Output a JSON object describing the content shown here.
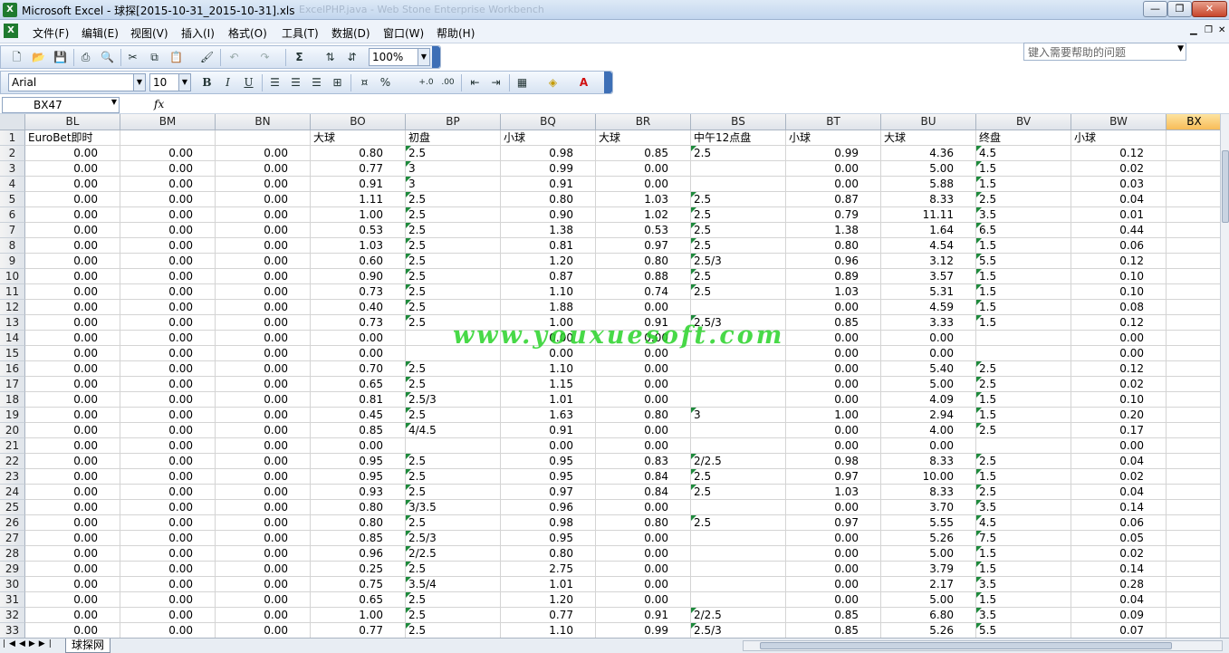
{
  "window": {
    "title": "Microsoft Excel - 球探[2015-10-31_2015-10-31].xls",
    "ghost_title": "ExcelPHP.java - Web Stone Enterprise Workbench",
    "icon": "excel-icon"
  },
  "menu": {
    "items": [
      "文件(F)",
      "编辑(E)",
      "视图(V)",
      "插入(I)",
      "格式(O)",
      "工具(T)",
      "数据(D)",
      "窗口(W)",
      "帮助(H)"
    ],
    "help_placeholder": "键入需要帮助的问题"
  },
  "toolbar": {
    "zoom": "100%",
    "font_name": "Arial",
    "font_size": "10",
    "sum_glyph": "Σ",
    "bold": "B",
    "italic": "I",
    "underline": "U",
    "percent": "%"
  },
  "formula_bar": {
    "name_box": "BX47",
    "fx": "fx",
    "value": ""
  },
  "sheet": {
    "columns": [
      "BL",
      "BM",
      "BN",
      "BO",
      "BP",
      "BQ",
      "BR",
      "BS",
      "BT",
      "BU",
      "BV",
      "BW",
      "BX"
    ],
    "selected_column": "BX",
    "rows": [
      {
        "n": "1",
        "cells": [
          "EuroBet即时",
          "",
          "",
          "大球",
          "初盘",
          "小球",
          "大球",
          "中午12点盘",
          "小球",
          "大球",
          "终盘",
          "小球",
          ""
        ]
      },
      {
        "n": "2",
        "cells": [
          "0.00",
          "0.00",
          "0.00",
          "0.80",
          "2.5",
          "0.98",
          "0.85",
          "2.5",
          "0.99",
          "4.36",
          "4.5",
          "0.12",
          ""
        ]
      },
      {
        "n": "3",
        "cells": [
          "0.00",
          "0.00",
          "0.00",
          "0.77",
          "3",
          "0.99",
          "0.00",
          "",
          "0.00",
          "5.00",
          "1.5",
          "0.02",
          ""
        ]
      },
      {
        "n": "4",
        "cells": [
          "0.00",
          "0.00",
          "0.00",
          "0.91",
          "3",
          "0.91",
          "0.00",
          "",
          "0.00",
          "5.88",
          "1.5",
          "0.03",
          ""
        ]
      },
      {
        "n": "5",
        "cells": [
          "0.00",
          "0.00",
          "0.00",
          "1.11",
          "2.5",
          "0.80",
          "1.03",
          "2.5",
          "0.87",
          "8.33",
          "2.5",
          "0.04",
          ""
        ]
      },
      {
        "n": "6",
        "cells": [
          "0.00",
          "0.00",
          "0.00",
          "1.00",
          "2.5",
          "0.90",
          "1.02",
          "2.5",
          "0.79",
          "11.11",
          "3.5",
          "0.01",
          ""
        ]
      },
      {
        "n": "7",
        "cells": [
          "0.00",
          "0.00",
          "0.00",
          "0.53",
          "2.5",
          "1.38",
          "0.53",
          "2.5",
          "1.38",
          "1.64",
          "6.5",
          "0.44",
          ""
        ]
      },
      {
        "n": "8",
        "cells": [
          "0.00",
          "0.00",
          "0.00",
          "1.03",
          "2.5",
          "0.81",
          "0.97",
          "2.5",
          "0.80",
          "4.54",
          "1.5",
          "0.06",
          ""
        ]
      },
      {
        "n": "9",
        "cells": [
          "0.00",
          "0.00",
          "0.00",
          "0.60",
          "2.5",
          "1.20",
          "0.80",
          "2.5/3",
          "0.96",
          "3.12",
          "5.5",
          "0.12",
          ""
        ]
      },
      {
        "n": "10",
        "cells": [
          "0.00",
          "0.00",
          "0.00",
          "0.90",
          "2.5",
          "0.87",
          "0.88",
          "2.5",
          "0.89",
          "3.57",
          "1.5",
          "0.10",
          ""
        ]
      },
      {
        "n": "11",
        "cells": [
          "0.00",
          "0.00",
          "0.00",
          "0.73",
          "2.5",
          "1.10",
          "0.74",
          "2.5",
          "1.03",
          "5.31",
          "1.5",
          "0.10",
          ""
        ]
      },
      {
        "n": "12",
        "cells": [
          "0.00",
          "0.00",
          "0.00",
          "0.40",
          "2.5",
          "1.88",
          "0.00",
          "",
          "0.00",
          "4.59",
          "1.5",
          "0.08",
          ""
        ]
      },
      {
        "n": "13",
        "cells": [
          "0.00",
          "0.00",
          "0.00",
          "0.73",
          "2.5",
          "1.00",
          "0.91",
          "2.5/3",
          "0.85",
          "3.33",
          "1.5",
          "0.12",
          ""
        ]
      },
      {
        "n": "14",
        "cells": [
          "0.00",
          "0.00",
          "0.00",
          "0.00",
          "",
          "0.00",
          "0.00",
          "",
          "0.00",
          "0.00",
          "",
          "0.00",
          ""
        ]
      },
      {
        "n": "15",
        "cells": [
          "0.00",
          "0.00",
          "0.00",
          "0.00",
          "",
          "0.00",
          "0.00",
          "",
          "0.00",
          "0.00",
          "",
          "0.00",
          ""
        ]
      },
      {
        "n": "16",
        "cells": [
          "0.00",
          "0.00",
          "0.00",
          "0.70",
          "2.5",
          "1.10",
          "0.00",
          "",
          "0.00",
          "5.40",
          "2.5",
          "0.12",
          ""
        ]
      },
      {
        "n": "17",
        "cells": [
          "0.00",
          "0.00",
          "0.00",
          "0.65",
          "2.5",
          "1.15",
          "0.00",
          "",
          "0.00",
          "5.00",
          "2.5",
          "0.02",
          ""
        ]
      },
      {
        "n": "18",
        "cells": [
          "0.00",
          "0.00",
          "0.00",
          "0.81",
          "2.5/3",
          "1.01",
          "0.00",
          "",
          "0.00",
          "4.09",
          "1.5",
          "0.10",
          ""
        ]
      },
      {
        "n": "19",
        "cells": [
          "0.00",
          "0.00",
          "0.00",
          "0.45",
          "2.5",
          "1.63",
          "0.80",
          "3",
          "1.00",
          "2.94",
          "1.5",
          "0.20",
          ""
        ]
      },
      {
        "n": "20",
        "cells": [
          "0.00",
          "0.00",
          "0.00",
          "0.85",
          "4/4.5",
          "0.91",
          "0.00",
          "",
          "0.00",
          "4.00",
          "2.5",
          "0.17",
          ""
        ]
      },
      {
        "n": "21",
        "cells": [
          "0.00",
          "0.00",
          "0.00",
          "0.00",
          "",
          "0.00",
          "0.00",
          "",
          "0.00",
          "0.00",
          "",
          "0.00",
          ""
        ]
      },
      {
        "n": "22",
        "cells": [
          "0.00",
          "0.00",
          "0.00",
          "0.95",
          "2.5",
          "0.95",
          "0.83",
          "2/2.5",
          "0.98",
          "8.33",
          "2.5",
          "0.04",
          ""
        ]
      },
      {
        "n": "23",
        "cells": [
          "0.00",
          "0.00",
          "0.00",
          "0.95",
          "2.5",
          "0.95",
          "0.84",
          "2.5",
          "0.97",
          "10.00",
          "1.5",
          "0.02",
          ""
        ]
      },
      {
        "n": "24",
        "cells": [
          "0.00",
          "0.00",
          "0.00",
          "0.93",
          "2.5",
          "0.97",
          "0.84",
          "2.5",
          "1.03",
          "8.33",
          "2.5",
          "0.04",
          ""
        ]
      },
      {
        "n": "25",
        "cells": [
          "0.00",
          "0.00",
          "0.00",
          "0.80",
          "3/3.5",
          "0.96",
          "0.00",
          "",
          "0.00",
          "3.70",
          "3.5",
          "0.14",
          ""
        ]
      },
      {
        "n": "26",
        "cells": [
          "0.00",
          "0.00",
          "0.00",
          "0.80",
          "2.5",
          "0.98",
          "0.80",
          "2.5",
          "0.97",
          "5.55",
          "4.5",
          "0.06",
          ""
        ]
      },
      {
        "n": "27",
        "cells": [
          "0.00",
          "0.00",
          "0.00",
          "0.85",
          "2.5/3",
          "0.95",
          "0.00",
          "",
          "0.00",
          "5.26",
          "7.5",
          "0.05",
          ""
        ]
      },
      {
        "n": "28",
        "cells": [
          "0.00",
          "0.00",
          "0.00",
          "0.96",
          "2/2.5",
          "0.80",
          "0.00",
          "",
          "0.00",
          "5.00",
          "1.5",
          "0.02",
          ""
        ]
      },
      {
        "n": "29",
        "cells": [
          "0.00",
          "0.00",
          "0.00",
          "0.25",
          "2.5",
          "2.75",
          "0.00",
          "",
          "0.00",
          "3.79",
          "1.5",
          "0.14",
          ""
        ]
      },
      {
        "n": "30",
        "cells": [
          "0.00",
          "0.00",
          "0.00",
          "0.75",
          "3.5/4",
          "1.01",
          "0.00",
          "",
          "0.00",
          "2.17",
          "3.5",
          "0.28",
          ""
        ]
      },
      {
        "n": "31",
        "cells": [
          "0.00",
          "0.00",
          "0.00",
          "0.65",
          "2.5",
          "1.20",
          "0.00",
          "",
          "0.00",
          "5.00",
          "1.5",
          "0.04",
          ""
        ]
      },
      {
        "n": "32",
        "cells": [
          "0.00",
          "0.00",
          "0.00",
          "1.00",
          "2.5",
          "0.77",
          "0.91",
          "2/2.5",
          "0.85",
          "6.80",
          "3.5",
          "0.09",
          ""
        ]
      },
      {
        "n": "33",
        "cells": [
          "0.00",
          "0.00",
          "0.00",
          "0.77",
          "2.5",
          "1.10",
          "0.99",
          "2.5/3",
          "0.85",
          "5.26",
          "5.5",
          "0.07",
          ""
        ]
      }
    ]
  },
  "watermark": "www.youxuesoft.com",
  "sheet_tab": "球探网"
}
